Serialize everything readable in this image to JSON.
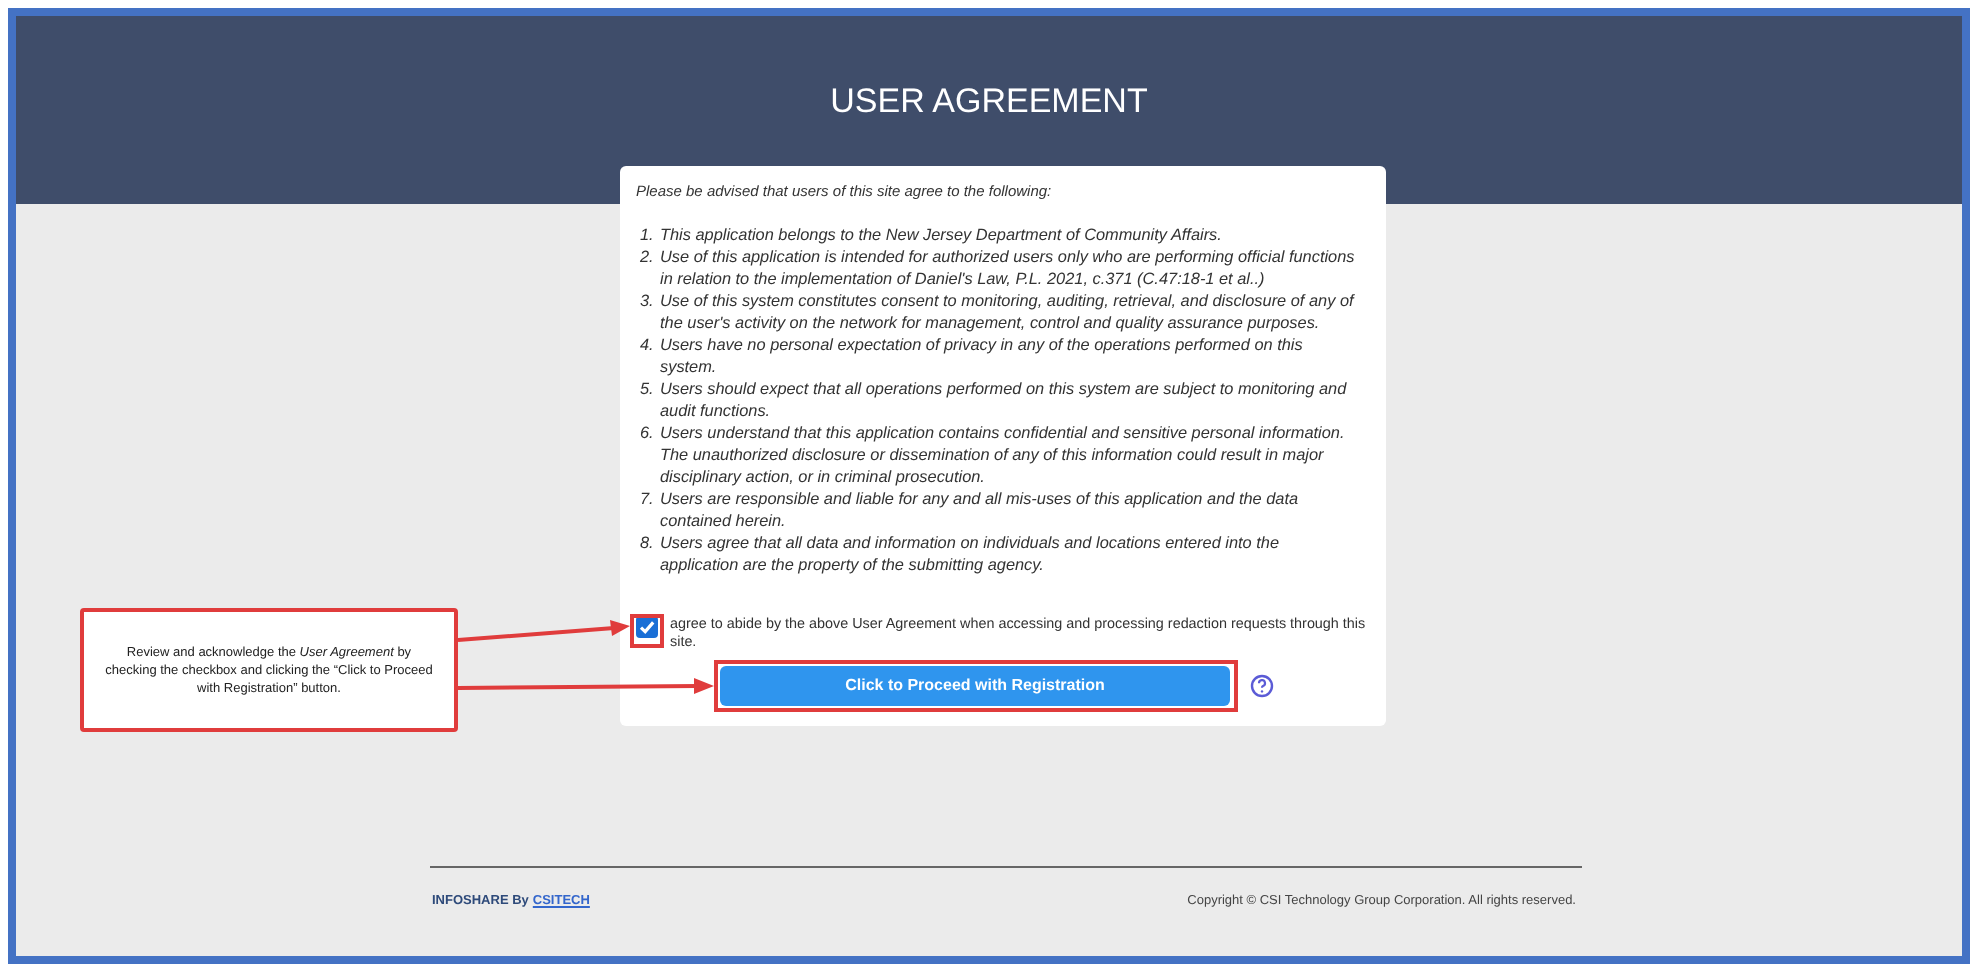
{
  "header": {
    "title": "USER AGREEMENT"
  },
  "agreement": {
    "intro": "Please be advised that users of this site agree to the following:",
    "terms": [
      {
        "number": "1.",
        "text": "This application belongs to the New Jersey Department of Community Affairs."
      },
      {
        "number": "2.",
        "text": "Use of this application is intended for authorized users only who are performing official functions in relation to the implementation of Daniel's Law, P.L. 2021, c.371 (C.47:18-1 et al..)"
      },
      {
        "number": "3.",
        "text": "Use of this system constitutes consent to monitoring, auditing, retrieval, and disclosure of any of the user's activity on the network for management, control and quality assurance purposes."
      },
      {
        "number": "4.",
        "text": "Users have no personal expectation of privacy in any of the operations performed on this system."
      },
      {
        "number": "5.",
        "text": "Users should expect that all operations performed on this system are subject to monitoring and audit functions."
      },
      {
        "number": "6.",
        "text": "Users understand that this application contains confidential and sensitive personal information. The unauthorized disclosure or dissemination of any of this information could result in major disciplinary action, or in criminal prosecution."
      },
      {
        "number": "7.",
        "text": "Users are responsible and liable for any and all mis-uses of this application and the data contained herein."
      },
      {
        "number": "8.",
        "text": "Users agree that all data and information on individuals and locations entered into the application are the property of the submitting agency."
      }
    ],
    "checkbox": {
      "label": "agree to abide by the above User Agreement when accessing and processing redaction requests through this site.",
      "checked": true
    },
    "button": "Click to Proceed with Registration"
  },
  "annotation": {
    "text": "Review and acknowledge the *User Agreement* by checking the checkbox and clicking the “Click to Proceed with Registration” button."
  },
  "footer": {
    "brand": "INFOSHARE By",
    "link": "CSITECH",
    "copyright": "Copyright © CSI Technology Group Corporation. All rights reserved."
  }
}
